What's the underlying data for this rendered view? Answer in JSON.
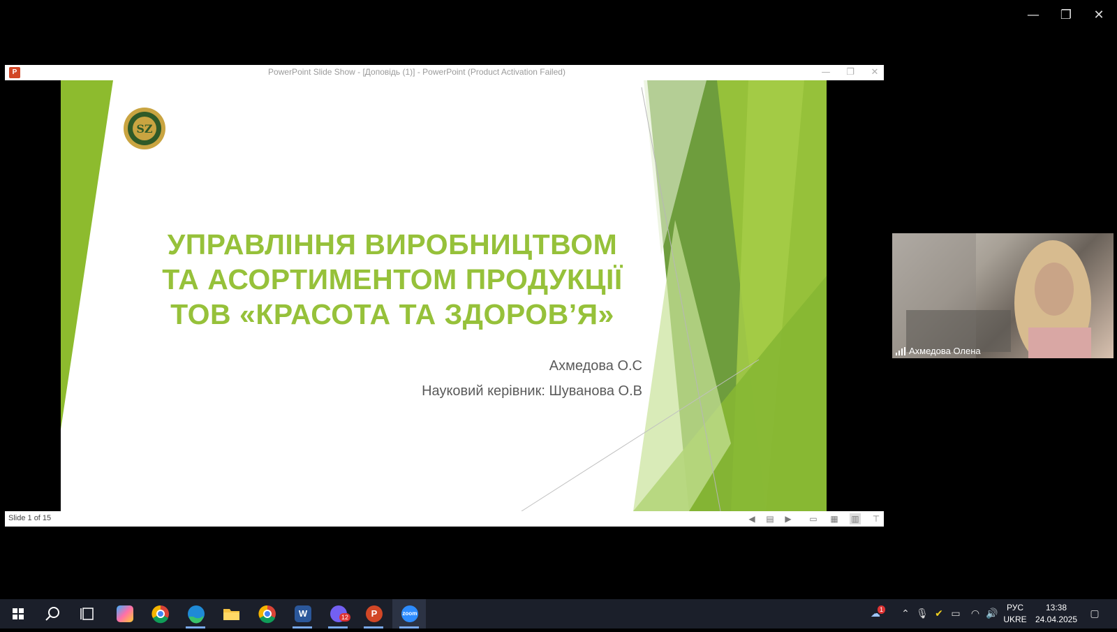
{
  "window": {
    "minimize_glyph": "—",
    "restore_glyph": "❐",
    "close_glyph": "✕"
  },
  "ppt": {
    "title": "PowerPoint Slide Show - [Доповідь (1)] - PowerPoint (Product Activation Failed)",
    "logo_text": "P",
    "status": "Slide 1 of 15"
  },
  "slide": {
    "title_line1": "УПРАВЛІННЯ ВИРОБНИЦТВОМ",
    "title_line2": "ТА АСОРТИМЕНТОМ ПРОДУКЦІЇ",
    "title_line3": "ТОВ «КРАСОТА ТА ЗДОРОВ’Я»",
    "author": "Ахмедова О.С",
    "advisor": "Науковий керівник: Шуванова О.В"
  },
  "video": {
    "participant_name": "Ахмедова Олена"
  },
  "taskbar": {
    "items": [
      {
        "name": "start-button",
        "icon": "windows-icon"
      },
      {
        "name": "search-button",
        "icon": "search-icon"
      },
      {
        "name": "task-view-button",
        "icon": "task-view-icon"
      },
      {
        "name": "copilot-app",
        "icon": "copilot-icon"
      },
      {
        "name": "chrome-app",
        "icon": "chrome-icon"
      },
      {
        "name": "edge-app",
        "icon": "edge-icon"
      },
      {
        "name": "file-explorer-app",
        "icon": "folder-icon"
      },
      {
        "name": "chrome-profile-app",
        "icon": "chrome-icon"
      },
      {
        "name": "word-app",
        "icon": "word-icon",
        "label": "W"
      },
      {
        "name": "viber-app",
        "icon": "viber-icon",
        "badge": "12"
      },
      {
        "name": "powerpoint-app",
        "icon": "powerpoint-icon",
        "label": "P"
      },
      {
        "name": "zoom-app",
        "icon": "zoom-icon",
        "label": "zoom"
      }
    ],
    "weather_badge": "1",
    "lang_line1": "РУС",
    "lang_line2": "UKRE",
    "time": "13:38",
    "date": "24.04.2025"
  }
}
